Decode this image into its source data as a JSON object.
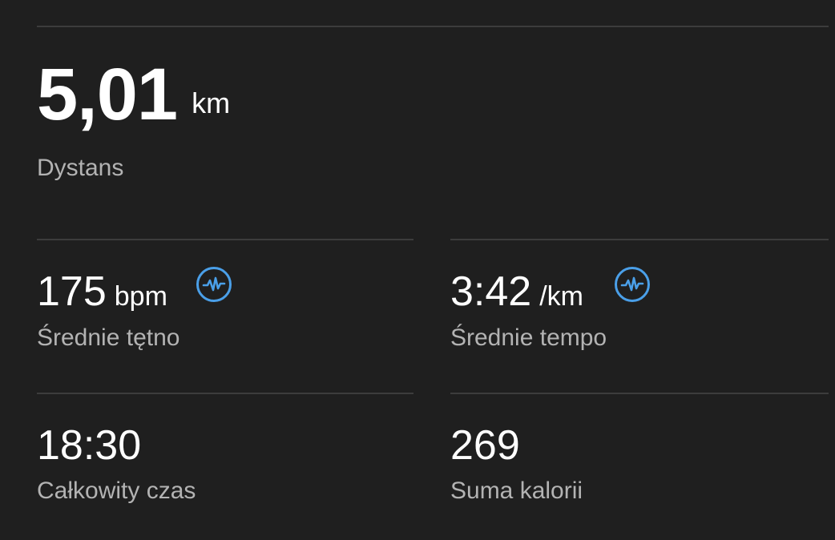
{
  "colors": {
    "background": "#1f1f1f",
    "divider": "#3c3c3c",
    "label": "#b3b3b3",
    "accent": "#4a9fe8"
  },
  "distance": {
    "value": "5,01",
    "unit": "km",
    "label": "Dystans"
  },
  "avg_heart_rate": {
    "value": "175",
    "unit": "bpm",
    "label": "Średnie tętno",
    "icon": "heart-rate-icon"
  },
  "avg_pace": {
    "value": "3:42",
    "unit": "/km",
    "label": "Średnie tempo",
    "icon": "heart-rate-icon"
  },
  "total_time": {
    "value": "18:30",
    "label": "Całkowity czas"
  },
  "total_calories": {
    "value": "269",
    "label": "Suma kalorii"
  }
}
